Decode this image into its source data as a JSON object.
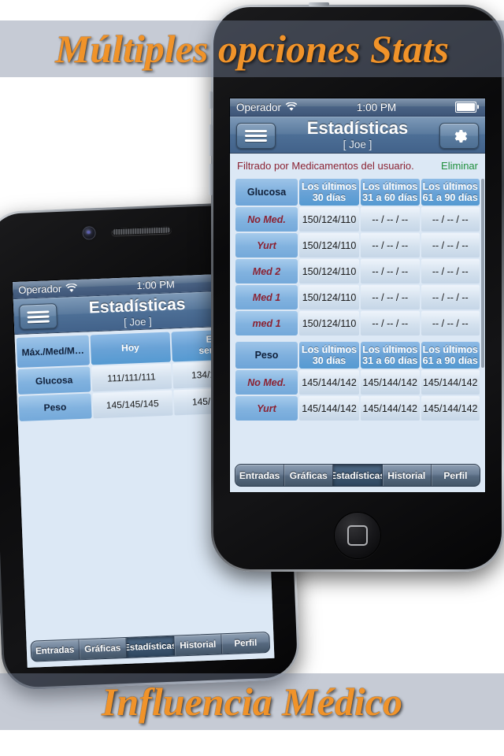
{
  "banner": {
    "top": "Múltiples opciones Stats",
    "bottom": "Influencia Médico"
  },
  "colors": {
    "background": "#5d6477",
    "banner_text": "#f0932a",
    "nav_blue": "#4d6f96",
    "content_bg": "#dce8f5",
    "row_label_text": "#8b2232",
    "clear_link": "#1f8f3c"
  },
  "front_phone": {
    "status_bar": {
      "carrier": "Operador",
      "wifi_icon": "wifi-icon",
      "time": "1:00 PM",
      "battery_icon": "battery-icon"
    },
    "nav": {
      "menu_icon": "hamburger-menu-icon",
      "title": "Estadísticas",
      "subtitle": "[ Joe ]",
      "settings_icon": "gear-icon"
    },
    "filter": {
      "text": "Filtrado por Medicamentos del usuario.",
      "clear_label": "Eliminar"
    },
    "tables": [
      {
        "header": [
          "Glucosa",
          "Los últimos 30 días",
          "Los últimos 31 a 60 días",
          "Los últimos 61 a 90 días"
        ],
        "header_lines": [
          [
            "Glucosa",
            ""
          ],
          [
            "Los últimos",
            "30 días"
          ],
          [
            "Los últimos",
            "31 a 60 días"
          ],
          [
            "Los últimos",
            "61 a 90 días"
          ]
        ],
        "rows": [
          {
            "label": "No Med.",
            "values": [
              "150/124/110",
              "-- / -- / --",
              "-- / -- / --"
            ]
          },
          {
            "label": "Yurt",
            "values": [
              "150/124/110",
              "-- / -- / --",
              "-- / -- / --"
            ]
          },
          {
            "label": "Med 2",
            "values": [
              "150/124/110",
              "-- / -- / --",
              "-- / -- / --"
            ]
          },
          {
            "label": "Med 1",
            "values": [
              "150/124/110",
              "-- / -- / --",
              "-- / -- / --"
            ]
          },
          {
            "label": "med 1",
            "values": [
              "150/124/110",
              "-- / -- / --",
              "-- / -- / --"
            ]
          }
        ]
      },
      {
        "header": [
          "Peso",
          "Los últimos 30 días",
          "Los últimos 31 a 60 días",
          "Los últimos 61 a 90 días"
        ],
        "header_lines": [
          [
            "Peso",
            ""
          ],
          [
            "Los últimos",
            "30 días"
          ],
          [
            "Los últimos",
            "31 a 60 días"
          ],
          [
            "Los últimos",
            "61 a 90 días"
          ]
        ],
        "rows": [
          {
            "label": "No Med.",
            "values": [
              "145/144/142",
              "145/144/142",
              "145/144/142"
            ]
          },
          {
            "label": "Yurt",
            "values": [
              "145/144/142",
              "145/144/142",
              "145/144/142"
            ]
          }
        ]
      }
    ],
    "tabs": [
      {
        "label": "Entradas",
        "active": false
      },
      {
        "label": "Gráficas",
        "active": false
      },
      {
        "label": "Estadísticas",
        "active": true
      },
      {
        "label": "Historial",
        "active": false
      },
      {
        "label": "Perfil",
        "active": false
      }
    ]
  },
  "back_phone": {
    "status_bar": {
      "carrier": "Operador",
      "wifi_icon": "wifi-icon",
      "time": "1:00 PM"
    },
    "nav": {
      "menu_icon": "hamburger-menu-icon",
      "title": "Estadísticas",
      "subtitle": "[ Joe ]"
    },
    "table": {
      "header_lines": [
        [
          "Máx./Med/M…",
          ""
        ],
        [
          "Hoy",
          ""
        ],
        [
          "Esta",
          "semana"
        ]
      ],
      "rows": [
        {
          "label": "Glucosa",
          "values": [
            "111/111/111",
            "134/120/110"
          ]
        },
        {
          "label": "Peso",
          "values": [
            "145/145/145",
            "145/144/143"
          ]
        }
      ]
    },
    "tabs": [
      {
        "label": "Entradas",
        "active": false
      },
      {
        "label": "Gráficas",
        "active": false
      },
      {
        "label": "Estadísticas",
        "active": true
      },
      {
        "label": "Historial",
        "active": false
      },
      {
        "label": "Perfil",
        "active": false
      }
    ]
  }
}
